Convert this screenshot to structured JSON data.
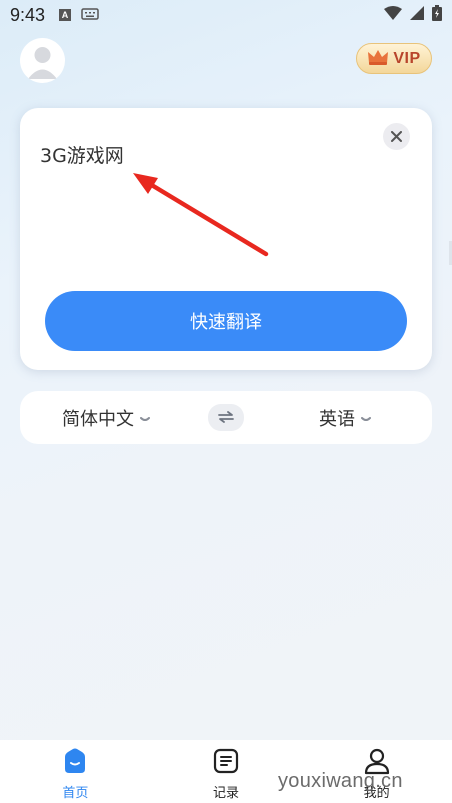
{
  "status_bar": {
    "time": "9:43",
    "keyboard_label": "A"
  },
  "header": {
    "vip_label": "VIP"
  },
  "input_card": {
    "text": "3G游戏网",
    "translate_button": "快速翻译"
  },
  "languages": {
    "source": "简体中文",
    "target": "英语"
  },
  "bottom_nav": {
    "items": [
      {
        "label": "首页",
        "icon": "home-icon",
        "active": true
      },
      {
        "label": "记录",
        "icon": "document-icon",
        "active": false
      },
      {
        "label": "我的",
        "icon": "person-icon",
        "active": false
      }
    ]
  },
  "watermark": "youxiwang.cn",
  "colors": {
    "accent": "#3a8bf8",
    "arrow": "#e8281f",
    "vip_text": "#b8452c"
  }
}
